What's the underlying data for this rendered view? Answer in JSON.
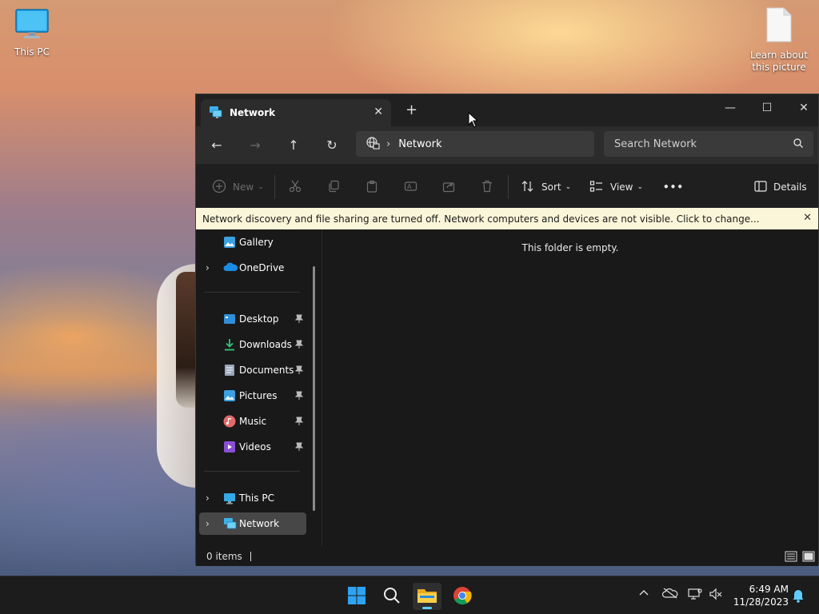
{
  "desktop": {
    "icons": [
      {
        "label": "This PC"
      },
      {
        "label": "Learn about this picture"
      }
    ]
  },
  "window": {
    "tab_title": "Network",
    "tab_close_glyph": "✕",
    "new_tab_glyph": "+",
    "minimize_glyph": "—",
    "maximize_glyph": "☐",
    "close_glyph": "✕"
  },
  "navbar": {
    "back_glyph": "←",
    "forward_glyph": "→",
    "up_glyph": "↑",
    "refresh_glyph": "↻",
    "breadcrumb": "Network",
    "search_placeholder": "Search Network"
  },
  "toolbar": {
    "new_label": "New",
    "sort_label": "Sort",
    "view_label": "View",
    "more_label": "•••",
    "details_label": "Details"
  },
  "banner": {
    "message": "Network discovery and file sharing are turned off. Network computers and devices are not visible. Click to change...",
    "close_glyph": "✕"
  },
  "sidebar": {
    "items": [
      {
        "label": "Gallery",
        "icon": "gallery-icon"
      },
      {
        "label": "OneDrive",
        "icon": "onedrive-icon"
      },
      {
        "label": "Desktop",
        "icon": "desktop-icon"
      },
      {
        "label": "Downloads",
        "icon": "downloads-icon"
      },
      {
        "label": "Documents",
        "icon": "documents-icon"
      },
      {
        "label": "Pictures",
        "icon": "pictures-icon"
      },
      {
        "label": "Music",
        "icon": "music-icon"
      },
      {
        "label": "Videos",
        "icon": "videos-icon"
      },
      {
        "label": "This PC",
        "icon": "this-pc-icon"
      },
      {
        "label": "Network",
        "icon": "network-icon"
      }
    ]
  },
  "content": {
    "empty_message": "This folder is empty."
  },
  "status": {
    "item_count": "0 items"
  },
  "taskbar": {
    "time": "6:49 AM",
    "date": "11/28/2023"
  },
  "colors": {
    "accent": "#60cdff",
    "banner_bg": "#fbf6d9",
    "window_bg": "#191919"
  }
}
